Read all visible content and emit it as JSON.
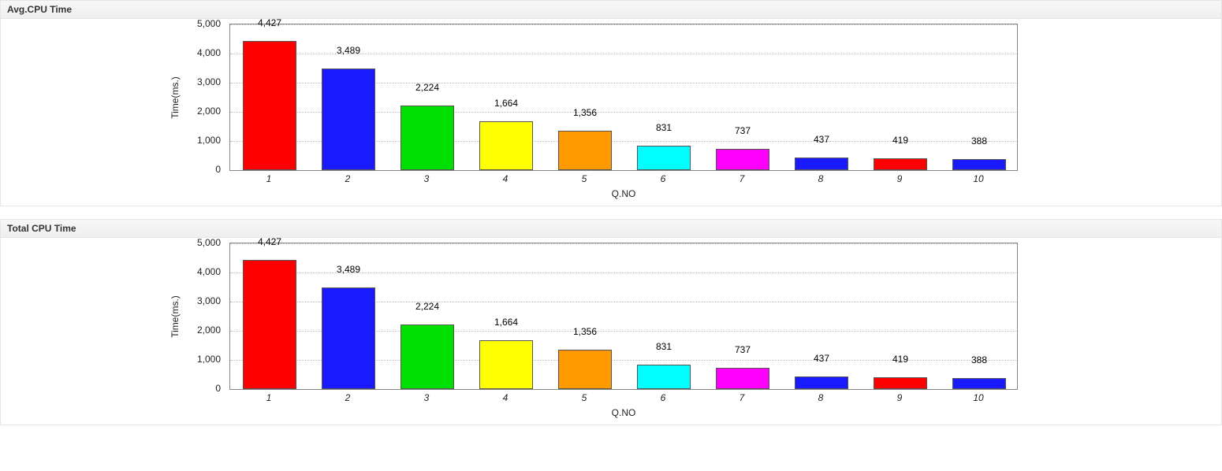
{
  "panels": [
    {
      "title": "Avg.CPU Time",
      "chart_key": 0
    },
    {
      "title": "Total CPU Time",
      "chart_key": 1
    }
  ],
  "chart_data": [
    {
      "type": "bar",
      "title": "Avg.CPU Time",
      "xlabel": "Q.NO",
      "ylabel": "Time(ms.)",
      "ylim": [
        0,
        5000
      ],
      "yticks": [
        0,
        1000,
        2000,
        3000,
        4000,
        5000
      ],
      "ytick_labels": [
        "0",
        "1,000",
        "2,000",
        "3,000",
        "4,000",
        "5,000"
      ],
      "categories": [
        "1",
        "2",
        "3",
        "4",
        "5",
        "6",
        "7",
        "8",
        "9",
        "10"
      ],
      "series": [
        {
          "name": "Avg.CPU Time",
          "values": [
            4427,
            3489,
            2224,
            1664,
            1356,
            831,
            737,
            437,
            419,
            388
          ],
          "value_labels": [
            "4,427",
            "3,489",
            "2,224",
            "1,664",
            "1,356",
            "831",
            "737",
            "437",
            "419",
            "388"
          ],
          "colors": [
            "#ff0000",
            "#1a1aff",
            "#00e000",
            "#ffff00",
            "#ff9900",
            "#00ffff",
            "#ff00ff",
            "#1a1aff",
            "#ff0000",
            "#1a1aff"
          ]
        }
      ]
    },
    {
      "type": "bar",
      "title": "Total CPU Time",
      "xlabel": "Q.NO",
      "ylabel": "Time(ms.)",
      "ylim": [
        0,
        5000
      ],
      "yticks": [
        0,
        1000,
        2000,
        3000,
        4000,
        5000
      ],
      "ytick_labels": [
        "0",
        "1,000",
        "2,000",
        "3,000",
        "4,000",
        "5,000"
      ],
      "categories": [
        "1",
        "2",
        "3",
        "4",
        "5",
        "6",
        "7",
        "8",
        "9",
        "10"
      ],
      "series": [
        {
          "name": "Total CPU Time",
          "values": [
            4427,
            3489,
            2224,
            1664,
            1356,
            831,
            737,
            437,
            419,
            388
          ],
          "value_labels": [
            "4,427",
            "3,489",
            "2,224",
            "1,664",
            "1,356",
            "831",
            "737",
            "437",
            "419",
            "388"
          ],
          "colors": [
            "#ff0000",
            "#1a1aff",
            "#00e000",
            "#ffff00",
            "#ff9900",
            "#00ffff",
            "#ff00ff",
            "#1a1aff",
            "#ff0000",
            "#1a1aff"
          ]
        }
      ]
    }
  ]
}
